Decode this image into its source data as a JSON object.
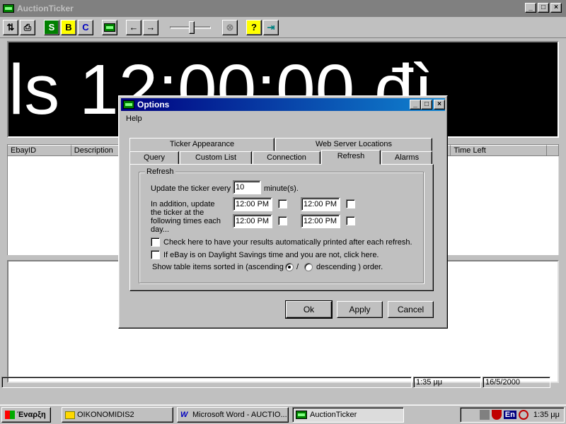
{
  "app": {
    "title": "AuctionTicker",
    "ticker_text": "ls 12:00:00 đì",
    "minimize": "_",
    "maximize": "□",
    "close": "×"
  },
  "toolbar": {
    "sort_icon": "⇅",
    "print_icon": "⎙",
    "s_label": "S",
    "b_label": "B",
    "c_label": "C",
    "left_arrow": "←",
    "right_arrow": "→",
    "stop_icon": "⊗",
    "help_icon": "?",
    "exit_icon": "⇥"
  },
  "columns": [
    "EbayID",
    "Description",
    "Time Left"
  ],
  "status": {
    "time": "1:35 μμ",
    "date": "16/5/2000"
  },
  "taskbar": {
    "start": "Έναρξη",
    "tasks": [
      "OIKONOMIDIS2",
      "Microsoft Word - AUCTIO...",
      "AuctionTicker"
    ],
    "lang": "En",
    "clock": "1:35 μμ"
  },
  "dialog": {
    "title": "Options",
    "menu_help": "Help",
    "tabs_back": [
      "Ticker Appearance",
      "Web Server Locations"
    ],
    "tabs_front": [
      "Query",
      "Custom List",
      "Connection",
      "Refresh",
      "Alarms"
    ],
    "group_label": "Refresh",
    "update_label": "Update the ticker every",
    "update_value": "10",
    "minutes_label": "minute(s).",
    "addition_label": [
      "In addition, update",
      "the ticker at the",
      "following times each",
      "day..."
    ],
    "times": [
      "12:00 PM",
      "12:00 PM",
      "12:00 PM",
      "12:00 PM"
    ],
    "print_check": "Check here to have your results automatically printed after each refresh.",
    "dst_check": "If eBay is on Daylight Savings time and you are not, click here.",
    "sort_label": "Show table items sorted in (ascending",
    "slash": "/",
    "desc_label": "descending ) order.",
    "ok": "Ok",
    "apply": "Apply",
    "cancel": "Cancel"
  }
}
